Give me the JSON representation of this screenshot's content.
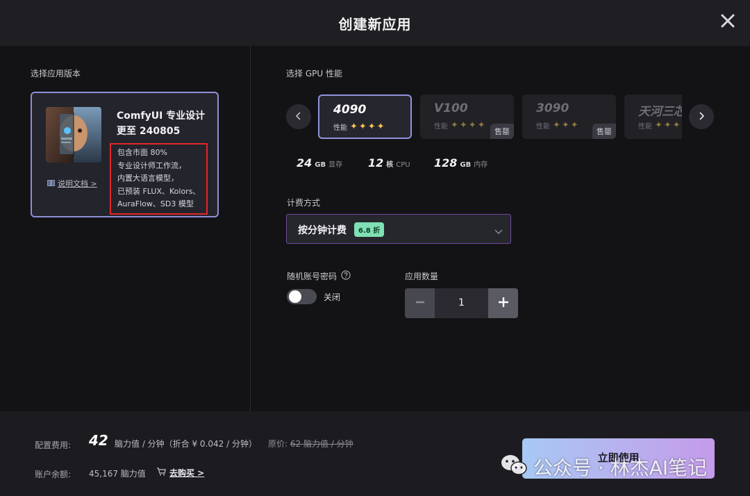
{
  "header": {
    "title": "创建新应用"
  },
  "left": {
    "section_label": "选择应用版本",
    "app": {
      "name_line1": "ComfyUI 专业设计",
      "name_line2": "更至 240805",
      "description": [
        "包含市面 80%",
        "专业设计师工作流，",
        "内置大语言模型，",
        "已预装 FLUX、Kolors、",
        "AuraFlow、SD3 模型"
      ],
      "doc_link": "说明文档 >"
    }
  },
  "gpu": {
    "section_label": "选择 GPU 性能",
    "perf_label": "性能",
    "sold_label": "售罄",
    "cards": [
      {
        "name": "4090",
        "stars": "✦✦✦✦",
        "selected": true,
        "sold_out": false
      },
      {
        "name": "V100",
        "stars": "✦✦✦✦",
        "selected": false,
        "sold_out": true
      },
      {
        "name": "3090",
        "stars": "✦✦✦",
        "selected": false,
        "sold_out": true
      },
      {
        "name": "天河三芯",
        "stars": "✦✦✦",
        "selected": false,
        "sold_out": false
      }
    ],
    "specs": [
      {
        "value": "24",
        "unit": "GB",
        "label": "显存"
      },
      {
        "value": "12",
        "unit": "核",
        "label": "CPU"
      },
      {
        "value": "128",
        "unit": "GB",
        "label": "内存"
      }
    ]
  },
  "billing": {
    "section_label": "计费方式",
    "selected": "按分钟计费",
    "discount": "6.8 折"
  },
  "random_account": {
    "label": "随机账号密码",
    "state": "关闭",
    "enabled": false
  },
  "quantity": {
    "label": "应用数量",
    "value": "1"
  },
  "footer": {
    "config_label": "配置费用:",
    "config_value": "42",
    "config_rate": "脑力值 / 分钟（折合 ¥ 0.042 / 分钟）",
    "original_prefix": "原价:",
    "original_value": "62 脑力值 / 分钟",
    "balance_label": "账户余额:",
    "balance_value": "45,167 脑力值",
    "buy_link": "去购买 >",
    "use_button": "立即使用"
  },
  "watermark": {
    "text": "公众号 · 林杰AI笔记"
  },
  "colors": {
    "accent_border": "#9393de",
    "star_active": "#f3c64e",
    "highlight_box": "#e5262a",
    "discount_badge": "#7fe0b4"
  }
}
